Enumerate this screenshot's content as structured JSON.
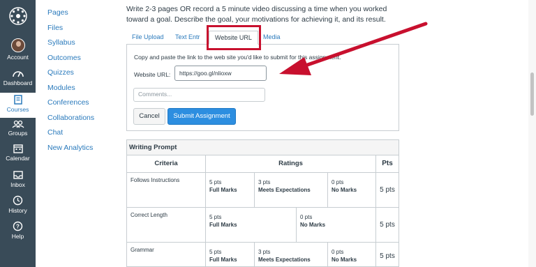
{
  "global_nav": {
    "items": [
      {
        "label": "Account",
        "icon": "avatar"
      },
      {
        "label": "Dashboard",
        "icon": "dashboard-icon"
      },
      {
        "label": "Courses",
        "icon": "courses-icon"
      },
      {
        "label": "Groups",
        "icon": "groups-icon"
      },
      {
        "label": "Calendar",
        "icon": "calendar-icon"
      },
      {
        "label": "Inbox",
        "icon": "inbox-icon"
      },
      {
        "label": "History",
        "icon": "history-icon"
      },
      {
        "label": "Help",
        "icon": "help-icon"
      }
    ]
  },
  "course_nav": {
    "items": [
      "Pages",
      "Files",
      "Syllabus",
      "Outcomes",
      "Quizzes",
      "Modules",
      "Conferences",
      "Collaborations",
      "Chat",
      "New Analytics"
    ]
  },
  "assignment": {
    "prompt": "Write 2-3 pages OR record a 5 minute video discussing a time when you worked toward a goal. Describe the goal, your motivations for achieving it, and its result."
  },
  "submission": {
    "tabs": [
      "File Upload",
      "Text Entr",
      "Website URL",
      "Media"
    ],
    "instructions": "Copy and paste the link to the web site you'd like to submit for this assignment.",
    "url_label": "Website URL:",
    "url_value": "https://goo.gl/nlioxw",
    "comments_placeholder": "Comments...",
    "cancel_label": "Cancel",
    "submit_label": "Submit Assignment"
  },
  "rubric": {
    "title": "Writing Prompt",
    "headers": {
      "criteria": "Criteria",
      "ratings": "Ratings",
      "pts": "Pts"
    },
    "rows": [
      {
        "criterion": "Follows Instructions",
        "ratings": [
          {
            "pts": "5 pts",
            "desc": "Full Marks"
          },
          {
            "pts": "3 pts",
            "desc": "Meets Expectations"
          },
          {
            "pts": "0 pts",
            "desc": "No Marks"
          }
        ],
        "points": "5 pts"
      },
      {
        "criterion": "Correct Length",
        "ratings": [
          {
            "pts": "5 pts",
            "desc": "Full Marks"
          },
          {
            "pts": "0 pts",
            "desc": "No Marks"
          }
        ],
        "points": "5 pts"
      },
      {
        "criterion": "Grammar",
        "ratings": [
          {
            "pts": "5 pts",
            "desc": "Full Marks"
          },
          {
            "pts": "3 pts",
            "desc": "Meets Expectations"
          },
          {
            "pts": "0 pts",
            "desc": "No Marks"
          }
        ],
        "points": "5 pts"
      }
    ]
  },
  "colors": {
    "nav_bg": "#394b58",
    "link": "#2a7abc",
    "primary_button": "#2d8ee0",
    "annotation": "#c8102e"
  }
}
